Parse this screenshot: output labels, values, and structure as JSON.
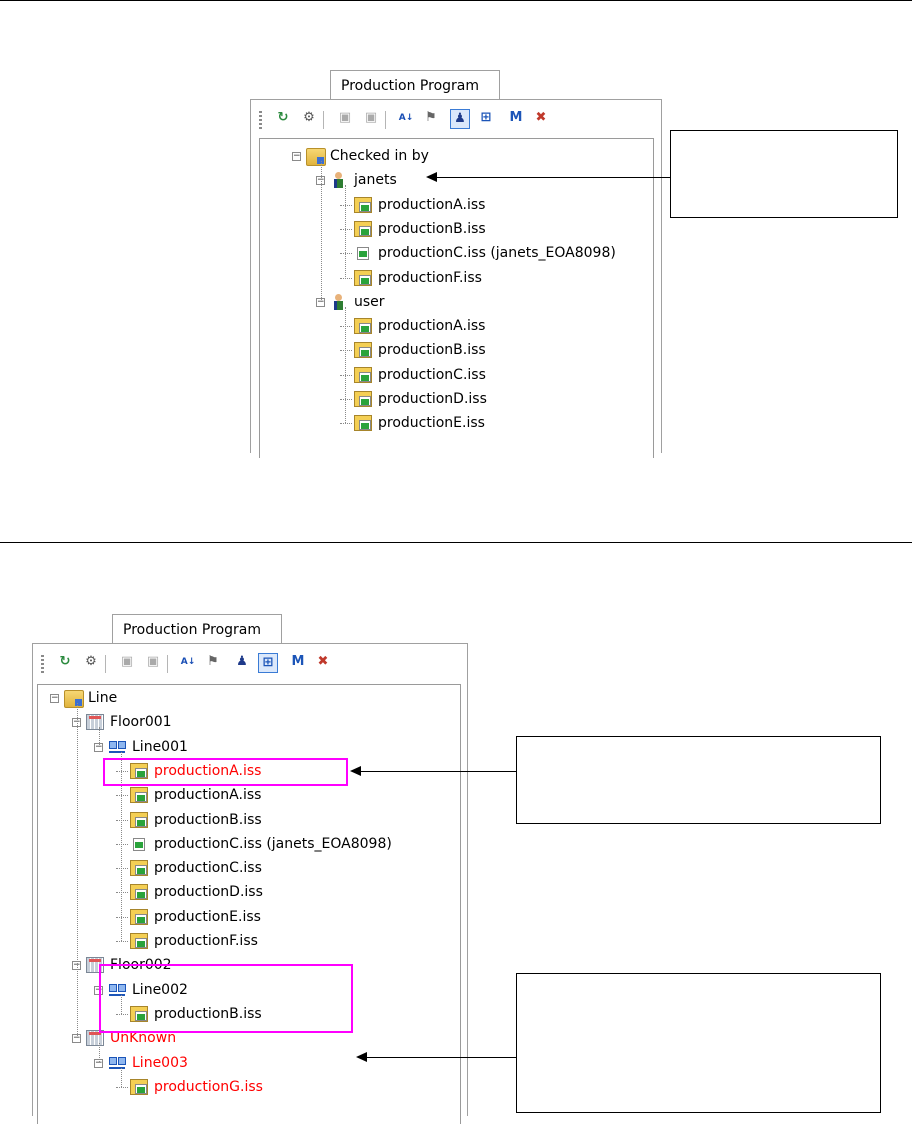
{
  "top_panel": {
    "tab_label": "Production Program",
    "tree": [
      {
        "label": "Checked in by",
        "icon": "folder-icon",
        "level": 0
      },
      {
        "label": "janets",
        "icon": "user-icon",
        "level": 1
      },
      {
        "label": "productionA.iss",
        "icon": "program-file-icon",
        "level": 2
      },
      {
        "label": "productionB.iss",
        "icon": "program-file-icon",
        "level": 2
      },
      {
        "label": "productionC.iss (janets_EOA8098)",
        "icon": "checked-out-file-icon",
        "level": 2
      },
      {
        "label": "productionF.iss",
        "icon": "program-file-icon",
        "level": 2
      },
      {
        "label": "user",
        "icon": "user-icon",
        "level": 1
      },
      {
        "label": "productionA.iss",
        "icon": "program-file-icon",
        "level": 2
      },
      {
        "label": "productionB.iss",
        "icon": "program-file-icon",
        "level": 2
      },
      {
        "label": "productionC.iss",
        "icon": "program-file-icon",
        "level": 2
      },
      {
        "label": "productionD.iss",
        "icon": "program-file-icon",
        "level": 2
      },
      {
        "label": "productionE.iss",
        "icon": "program-file-icon",
        "level": 2
      }
    ]
  },
  "bottom_panel": {
    "tab_label": "Production Program",
    "tree": [
      {
        "label": "Line",
        "icon": "folder-icon",
        "level": 0
      },
      {
        "label": "Floor001",
        "icon": "floor-icon",
        "level": 1
      },
      {
        "label": "Line001",
        "icon": "line-icon",
        "level": 2
      },
      {
        "label": "productionA.iss",
        "icon": "program-file-icon",
        "level": 3,
        "highlight": true
      },
      {
        "label": "productionA.iss",
        "icon": "program-file-icon",
        "level": 3
      },
      {
        "label": "productionB.iss",
        "icon": "program-file-icon",
        "level": 3
      },
      {
        "label": "productionC.iss (janets_EOA8098)",
        "icon": "checked-out-file-icon",
        "level": 3
      },
      {
        "label": "productionC.iss",
        "icon": "program-file-icon",
        "level": 3
      },
      {
        "label": "productionD.iss",
        "icon": "program-file-icon",
        "level": 3
      },
      {
        "label": "productionE.iss",
        "icon": "program-file-icon",
        "level": 3
      },
      {
        "label": "productionF.iss",
        "icon": "program-file-icon",
        "level": 3
      },
      {
        "label": "Floor002",
        "icon": "floor-icon",
        "level": 1
      },
      {
        "label": "Line002",
        "icon": "line-icon",
        "level": 2
      },
      {
        "label": "productionB.iss",
        "icon": "program-file-icon",
        "level": 3
      },
      {
        "label": "UnKnown",
        "icon": "floor-icon",
        "level": 1,
        "highlight": true
      },
      {
        "label": "Line003",
        "icon": "line-icon",
        "level": 2,
        "highlight": true
      },
      {
        "label": "productionG.iss",
        "icon": "program-file-icon",
        "level": 3,
        "highlight": true
      }
    ]
  },
  "toolbar_buttons": [
    "refresh-icon",
    "properties-icon",
    "check-in-icon",
    "check-out-icon",
    "sort-az-icon",
    "filter-icon",
    "group-by-user-icon",
    "group-by-line-icon",
    "macro-icon",
    "delete-icon"
  ],
  "colors": {
    "highlight_text": "#ff0000",
    "highlight_box": "#ff00ff",
    "selected_button": "#3a7bd5"
  }
}
